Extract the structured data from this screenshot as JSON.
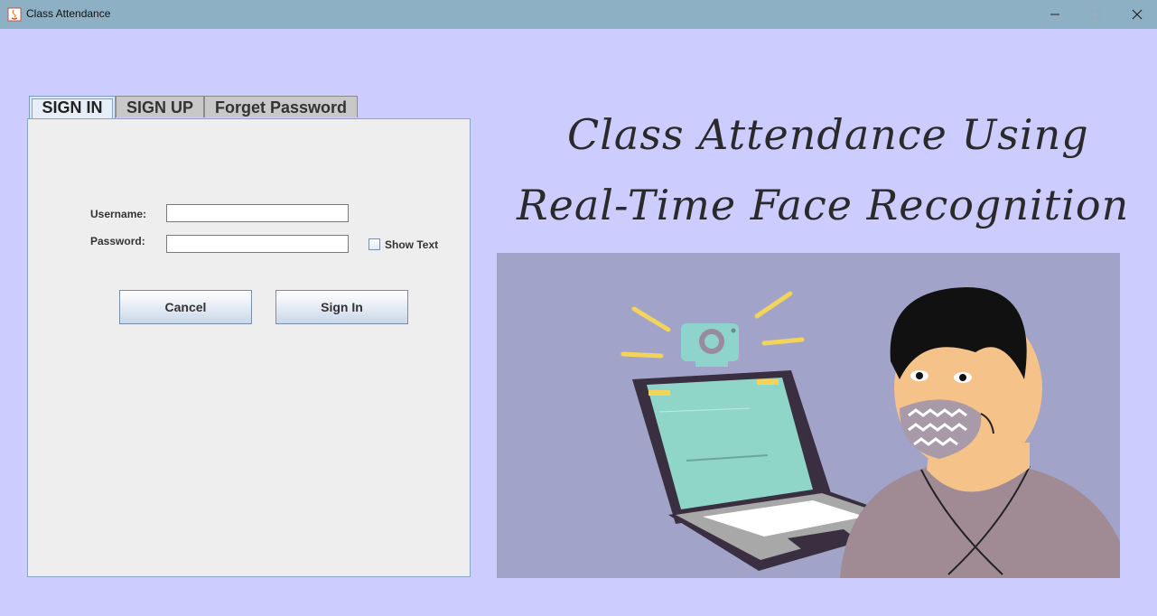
{
  "window": {
    "title": "Class Attendance"
  },
  "tabs": [
    {
      "label": "SIGN IN",
      "active": true
    },
    {
      "label": "SIGN UP",
      "active": false
    },
    {
      "label": "Forget Password",
      "active": false
    }
  ],
  "form": {
    "username_label": "Username:",
    "username_value": "",
    "password_label": "Password:",
    "password_value": "",
    "show_text_label": "Show Text",
    "show_text_checked": false,
    "cancel_label": "Cancel",
    "sign_in_label": "Sign In"
  },
  "heading": {
    "line1": "Class Attendance Using",
    "line2": "Real-Time Face Recognition"
  },
  "colors": {
    "background": "#ccccff",
    "titlebar": "#8eb0c4",
    "illustration_bg": "#a1a3c9"
  }
}
